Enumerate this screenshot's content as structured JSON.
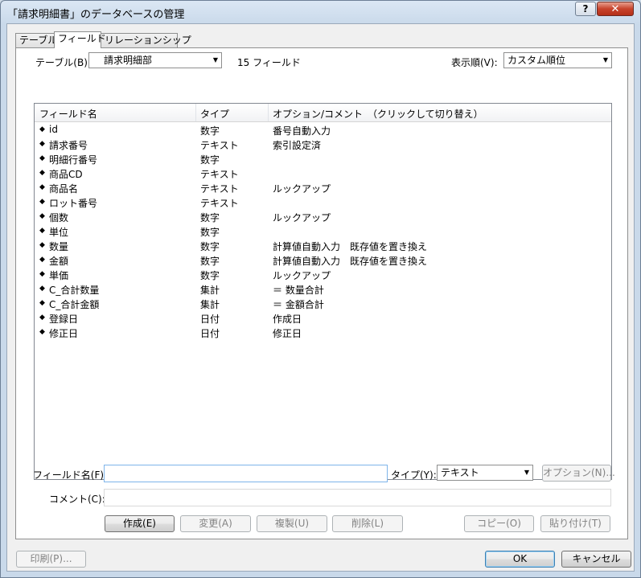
{
  "window": {
    "title": "「請求明細書」のデータベースの管理"
  },
  "titlebar": {
    "help": "?",
    "close": "✕"
  },
  "tabs": [
    "テーブル",
    "フィールド",
    "リレーションシップ"
  ],
  "table_selector": {
    "label": "テーブル(B):",
    "value": "請求明細部",
    "field_count": "15 フィールド"
  },
  "sort": {
    "label": "表示順(V):",
    "value": "カスタム順位"
  },
  "columns": {
    "name": "フィールド名",
    "type": "タイプ",
    "options": "オプション/コメント　（クリックして切り替え）"
  },
  "fields": [
    {
      "name": "id",
      "type": "数字",
      "options": "番号自動入力"
    },
    {
      "name": "請求番号",
      "type": "テキスト",
      "options": "索引設定済"
    },
    {
      "name": "明細行番号",
      "type": "数字",
      "options": ""
    },
    {
      "name": "商品CD",
      "type": "テキスト",
      "options": ""
    },
    {
      "name": "商品名",
      "type": "テキスト",
      "options": "ルックアップ"
    },
    {
      "name": "ロット番号",
      "type": "テキスト",
      "options": ""
    },
    {
      "name": "個数",
      "type": "数字",
      "options": "ルックアップ"
    },
    {
      "name": "単位",
      "type": "数字",
      "options": ""
    },
    {
      "name": "数量",
      "type": "数字",
      "options": "計算値自動入力　既存値を置き換え"
    },
    {
      "name": "金額",
      "type": "数字",
      "options": "計算値自動入力　既存値を置き換え"
    },
    {
      "name": "単価",
      "type": "数字",
      "options": "ルックアップ"
    },
    {
      "name": "C_合計数量",
      "type": "集計",
      "options": "＝ 数量合計"
    },
    {
      "name": "C_合計金額",
      "type": "集計",
      "options": "＝ 金額合計"
    },
    {
      "name": "登録日",
      "type": "日付",
      "options": "作成日"
    },
    {
      "name": "修正日",
      "type": "日付",
      "options": "修正日"
    }
  ],
  "form": {
    "field_name_label": "フィールド名(F):",
    "field_name_value": "",
    "type_label": "タイプ(Y):",
    "type_value": "テキスト",
    "options_button": "オプション(N)...",
    "comment_label": "コメント(C):",
    "comment_value": ""
  },
  "actions": {
    "create": "作成(E)",
    "change": "変更(A)",
    "duplicate": "複製(U)",
    "delete": "削除(L)",
    "copy": "コピー(O)",
    "paste": "貼り付け(T)"
  },
  "footer": {
    "print": "印刷(P)...",
    "ok": "OK",
    "cancel": "キャンセル"
  },
  "colors": {
    "accent": "#3c7fb1",
    "titlebar": "#c9d9ea",
    "close": "#c7432c"
  }
}
